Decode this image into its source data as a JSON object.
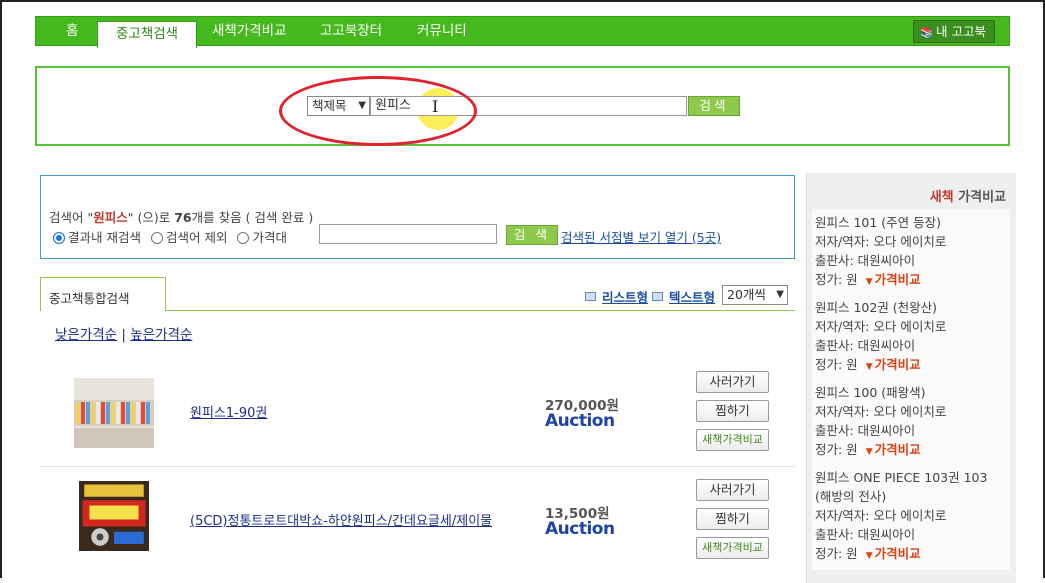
{
  "nav": {
    "tabs": [
      {
        "label": "홈"
      },
      {
        "label": "중고책검색"
      },
      {
        "label": "새책가격비교"
      },
      {
        "label": "고고북장터"
      },
      {
        "label": "커뮤니티"
      }
    ],
    "my_button": "내 고고북"
  },
  "search": {
    "select_value": "책제목",
    "query": "원피스",
    "button": "검색"
  },
  "result": {
    "prefix": "검색어 \"",
    "keyword": "원피스",
    "middle": "\" (으)로 ",
    "count": "76",
    "suffix": "개를 찾음 ( 검색 완료 )",
    "options": [
      "결과내 재검색",
      "검색어 제외",
      "가격대"
    ],
    "button": "검 색",
    "store_link": "검색된 서점별 보기 열기 (5곳)"
  },
  "listing": {
    "tab": "중고책통합검색",
    "view_list": "리스트형",
    "view_text": "텍스트형",
    "per_page": "20개씩",
    "sort_low": "낮은가격순",
    "sort_sep": "|",
    "sort_high": "높은가격순",
    "items": [
      {
        "title": "원피스1-90권",
        "price": "270,000원",
        "seller": "Auction",
        "buy": "사러가기",
        "pick": "찜하기",
        "compare": "새책가격비교"
      },
      {
        "title": "(5CD)정통트로트대박쇼-하얀원피스/간데요글세/제이물",
        "price": "13,500원",
        "seller": "Auction",
        "buy": "사러가기",
        "pick": "찜하기",
        "compare": "새책가격비교"
      }
    ]
  },
  "sidebar": {
    "title_red": "새책",
    "title_rest": " 가격비교",
    "items": [
      {
        "title": "원피스 101 (주연 등장)",
        "author": "저자/역자: 오다 에이치로",
        "publisher": "출판사: 대원씨아이",
        "price": "정가: 원",
        "compare": "가격비교"
      },
      {
        "title": "원피스 102권 (천왕산)",
        "author": "저자/역자: 오다 에이치로",
        "publisher": "출판사: 대원씨아이",
        "price": "정가: 원",
        "compare": "가격비교"
      },
      {
        "title": "원피스 100 (패왕색)",
        "author": "저자/역자: 오다 에이치로",
        "publisher": "출판사: 대원씨아이",
        "price": "정가: 원",
        "compare": "가격비교"
      },
      {
        "title": "원피스 ONE PIECE 103권 103 (해방의 전사)",
        "author": "저자/역자: 오다 에이치로",
        "publisher": "출판사: 대원씨아이",
        "price": "정가: 원",
        "compare": "가격비교"
      }
    ]
  }
}
